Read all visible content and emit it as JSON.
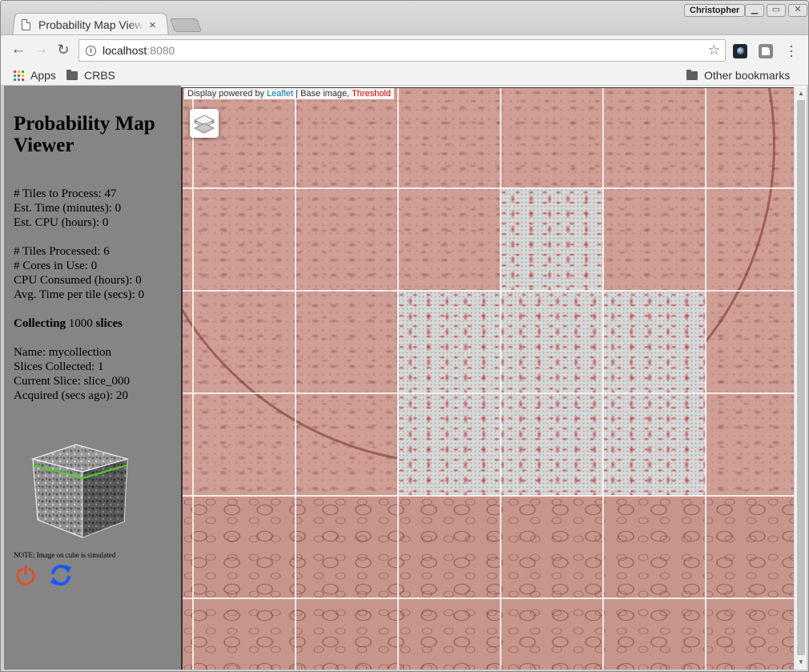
{
  "browser": {
    "tab_title": "Probability Map Viewer",
    "tab_close": "×",
    "profile_name": "Christopher",
    "url_host": "localhost",
    "url_port": ":8080",
    "bookmarks": {
      "apps": "Apps",
      "crbs": "CRBS",
      "other": "Other bookmarks"
    }
  },
  "sidebar": {
    "title": "Probability Map Viewer",
    "tiles_to_process": "# Tiles to Process: 47",
    "est_time": "Est. Time (minutes): 0",
    "est_cpu": "Est. CPU (hours): 0",
    "tiles_processed": "# Tiles Processed: 6",
    "cores_in_use": "# Cores in Use: 0",
    "cpu_consumed": "CPU Consumed (hours): 0",
    "avg_time": "Avg. Time per tile (secs): 0",
    "collecting_prefix": "Collecting",
    "collecting_count": "1000",
    "collecting_suffix": "slices",
    "name": "Name: mycollection",
    "slices_collected": "Slices Collected: 1",
    "current_slice": "Current Slice: slice_000",
    "acquired": "Acquired (secs ago): 20",
    "note": "NOTE: Image on cube is simulated",
    "power_icon": "power-icon",
    "refresh_icon": "refresh-icon"
  },
  "map": {
    "attribution_prefix": "Display powered by",
    "attribution_leaflet": "Leaflet",
    "attribution_sep": "| Base image,",
    "attribution_threshold": "Threshold",
    "layers_icon": "layers-icon"
  },
  "colors": {
    "sidebar_bg": "#858585",
    "overlay_red": "#cf9e95",
    "power_red": "#e0502a",
    "refresh_blue": "#1a5bff",
    "threshold_red": "#cc0000",
    "leaflet_blue": "#0078a8"
  }
}
